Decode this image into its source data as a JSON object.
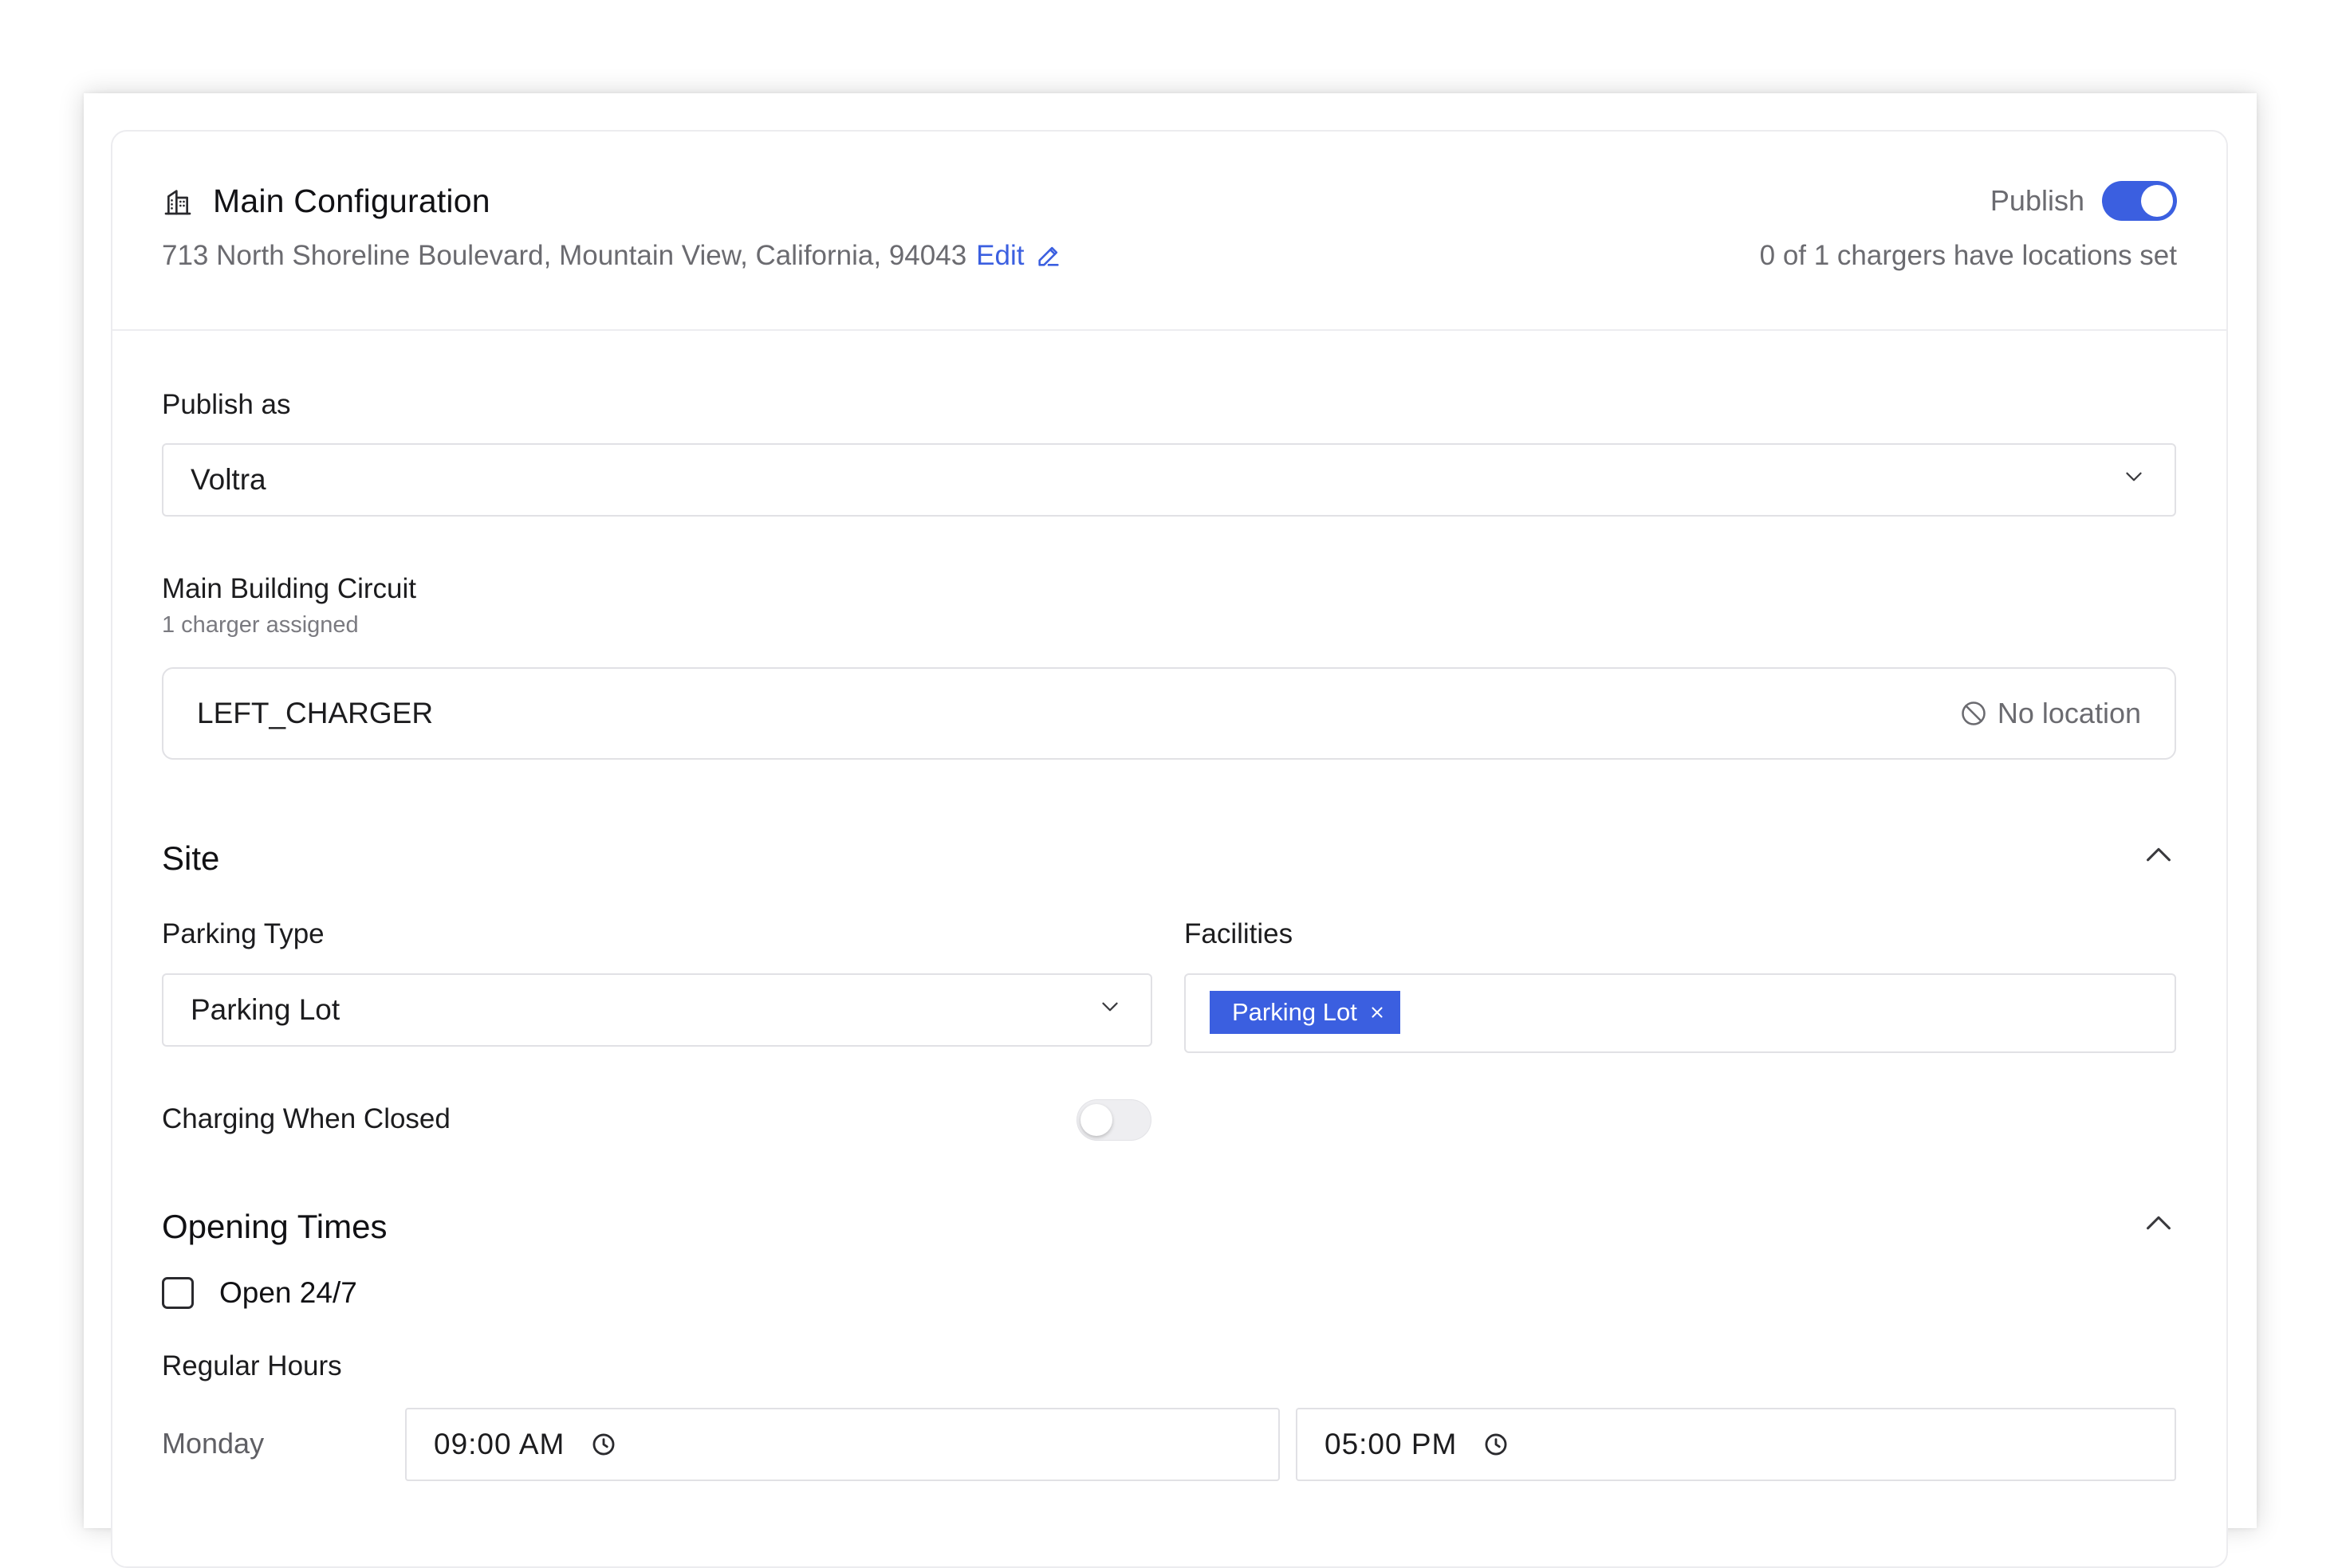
{
  "header": {
    "title": "Main Configuration",
    "address": "713 North Shoreline Boulevard, Mountain View, California, 94043",
    "edit_label": "Edit",
    "publish_label": "Publish",
    "publish_enabled": true,
    "chargers_status": "0 of 1 chargers have locations set"
  },
  "publish_as": {
    "label": "Publish as",
    "value": "Voltra"
  },
  "circuit": {
    "label": "Main Building Circuit",
    "sublabel": "1 charger assigned",
    "charger_name": "LEFT_CHARGER",
    "location_status": "No location"
  },
  "site": {
    "title": "Site",
    "expanded": true,
    "parking_type_label": "Parking Type",
    "parking_type_value": "Parking Lot",
    "facilities_label": "Facilities",
    "facilities_tags": [
      "Parking Lot"
    ],
    "charging_when_closed_label": "Charging When Closed",
    "charging_when_closed_enabled": false
  },
  "opening_times": {
    "title": "Opening Times",
    "expanded": true,
    "open_24_7_label": "Open 24/7",
    "open_24_7_checked": false,
    "regular_hours_label": "Regular Hours",
    "days": [
      {
        "day": "Monday",
        "open": "09:00 AM",
        "close": "05:00 PM"
      }
    ]
  },
  "colors": {
    "accent": "#3b5fe0",
    "text": "#1c1c1e",
    "muted": "#6b6b70",
    "border": "#e1e1e5"
  }
}
